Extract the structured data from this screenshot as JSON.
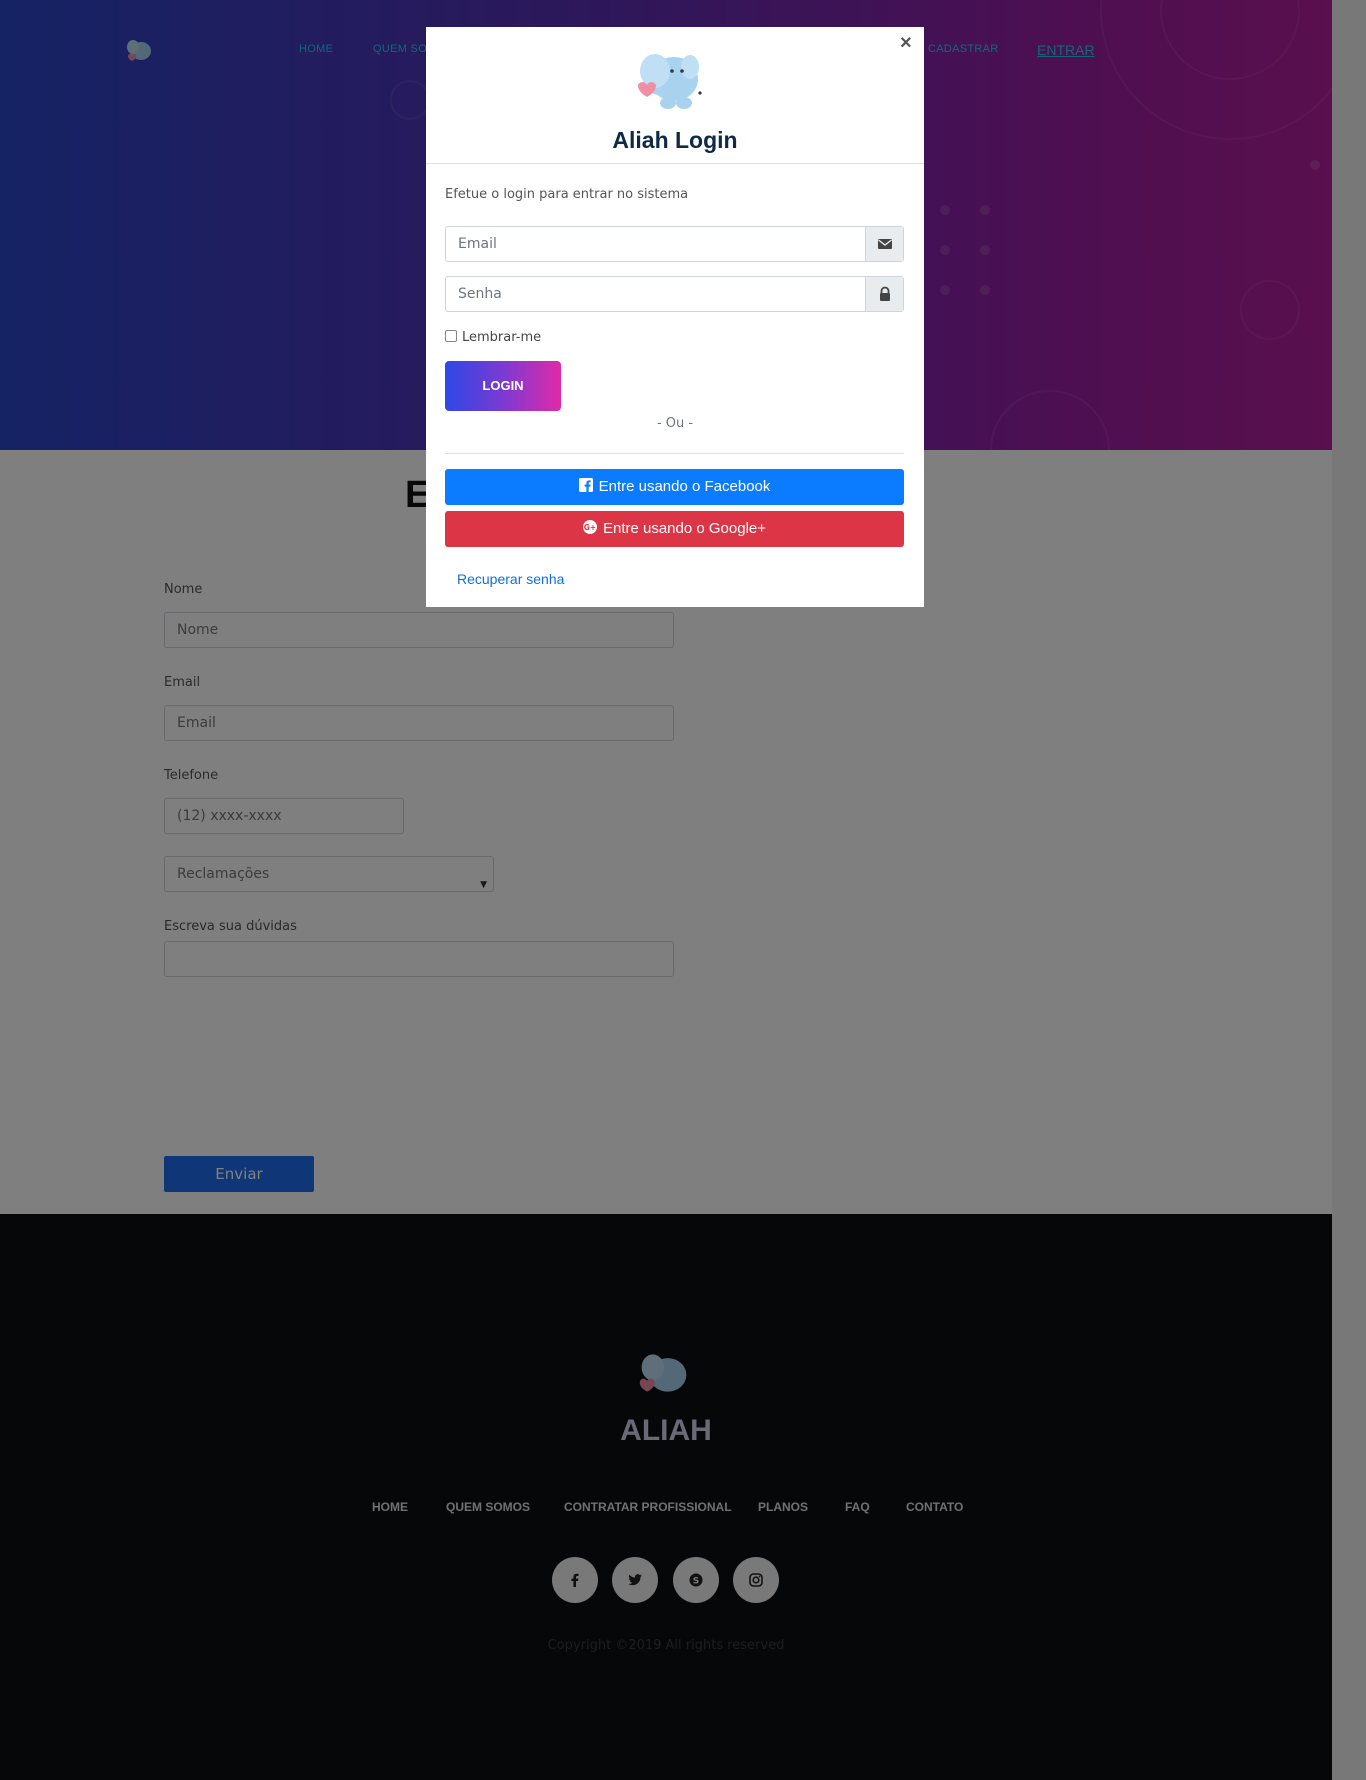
{
  "nav": {
    "home": "HOME",
    "quem_somos": "QUEM SOMOS",
    "cadastrar": "CADASTRAR",
    "entrar": "ENTRAR"
  },
  "contact": {
    "title": "E",
    "nome_label": "Nome",
    "nome_placeholder": "Nome",
    "email_label": "Email",
    "email_placeholder": "Email",
    "telefone_label": "Telefone",
    "telefone_placeholder": "(12) xxxx-xxxx",
    "select_value": "Reclamações",
    "duvidas_label": "Escreva sua dúvidas",
    "send_label": "Enviar"
  },
  "footer": {
    "brand": "ALIAH",
    "links": [
      "HOME",
      "QUEM SOMOS",
      "CONTRATAR PROFISSIONAL",
      "PLANOS",
      "FAQ",
      "CONTATO"
    ],
    "social_icons": [
      "facebook-icon",
      "twitter-icon",
      "skype-icon",
      "instagram-icon"
    ],
    "copyright": "Copyright ©2019 All rights reserved"
  },
  "modal": {
    "close": "×",
    "title": "Aliah Login",
    "subtitle": "Efetue o login para entrar no sistema",
    "email_placeholder": "Email",
    "senha_placeholder": "Senha",
    "remember_label": "Lembrar-me",
    "login_label": "LOGIN",
    "or_text": "- Ou -",
    "facebook_label": "Entre usando o Facebook",
    "google_label": "Entre usando o Google+",
    "recover_label": "Recuperar senha"
  },
  "colors": {
    "hero_start": "#2a46c9",
    "hero_end": "#b41e9c",
    "facebook": "#0b7bff",
    "google": "#dc3545",
    "link": "#0f6fdc",
    "nav_accent": "#22d0f0",
    "modal_title": "#0e2a47"
  }
}
